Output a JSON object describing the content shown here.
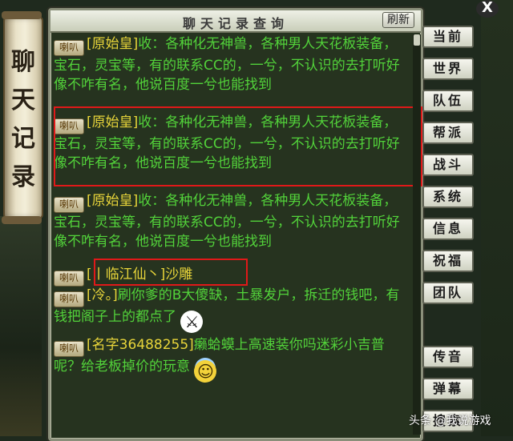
{
  "window": {
    "title": "聊天记录查询",
    "refresh_label": "刷新",
    "close_symbol": "X"
  },
  "side_banner": {
    "title": "聊天记录"
  },
  "horn_icon": "喇叭",
  "messages": [
    {
      "name": "[原始皇]",
      "text": "收：各种化无神兽，各种男人天花板装备，宝石，灵宝等，有的联系CC的，一兮，不认识的去打听好像不咋有名，他说百度一兮也能找到"
    },
    {
      "name": "[原始皇]",
      "text": "收：各种化无神兽，各种男人天花板装备，宝石，灵宝等，有的联系CC的，一兮，不认识的去打听好像不咋有名，他说百度一兮也能找到"
    },
    {
      "name": "[原始皇]",
      "text": "收：各种化无神兽，各种男人天花板装备，宝石，灵宝等，有的联系CC的，一兮，不认识的去打听好像不咋有名，他说百度一兮也能找到"
    },
    {
      "name": "[丨临江仙丶]",
      "text": "沙雕"
    },
    {
      "name": "[冷。]",
      "text": "刷你爹的B大傻缺，土暴发户，拆迁的钱吧，有钱把阁子上的都点了"
    },
    {
      "name": "[名字36488255]",
      "text": "癞蛤蟆上高速装你吗迷彩小吉普呢？给老板掉价的玩意"
    }
  ],
  "channels": [
    "当前",
    "世界",
    "队伍",
    "帮派",
    "战斗",
    "系统",
    "信息",
    "祝福",
    "团队",
    "传音",
    "弹幕",
    "搜索"
  ],
  "watermark": "头条 @我说游戏"
}
